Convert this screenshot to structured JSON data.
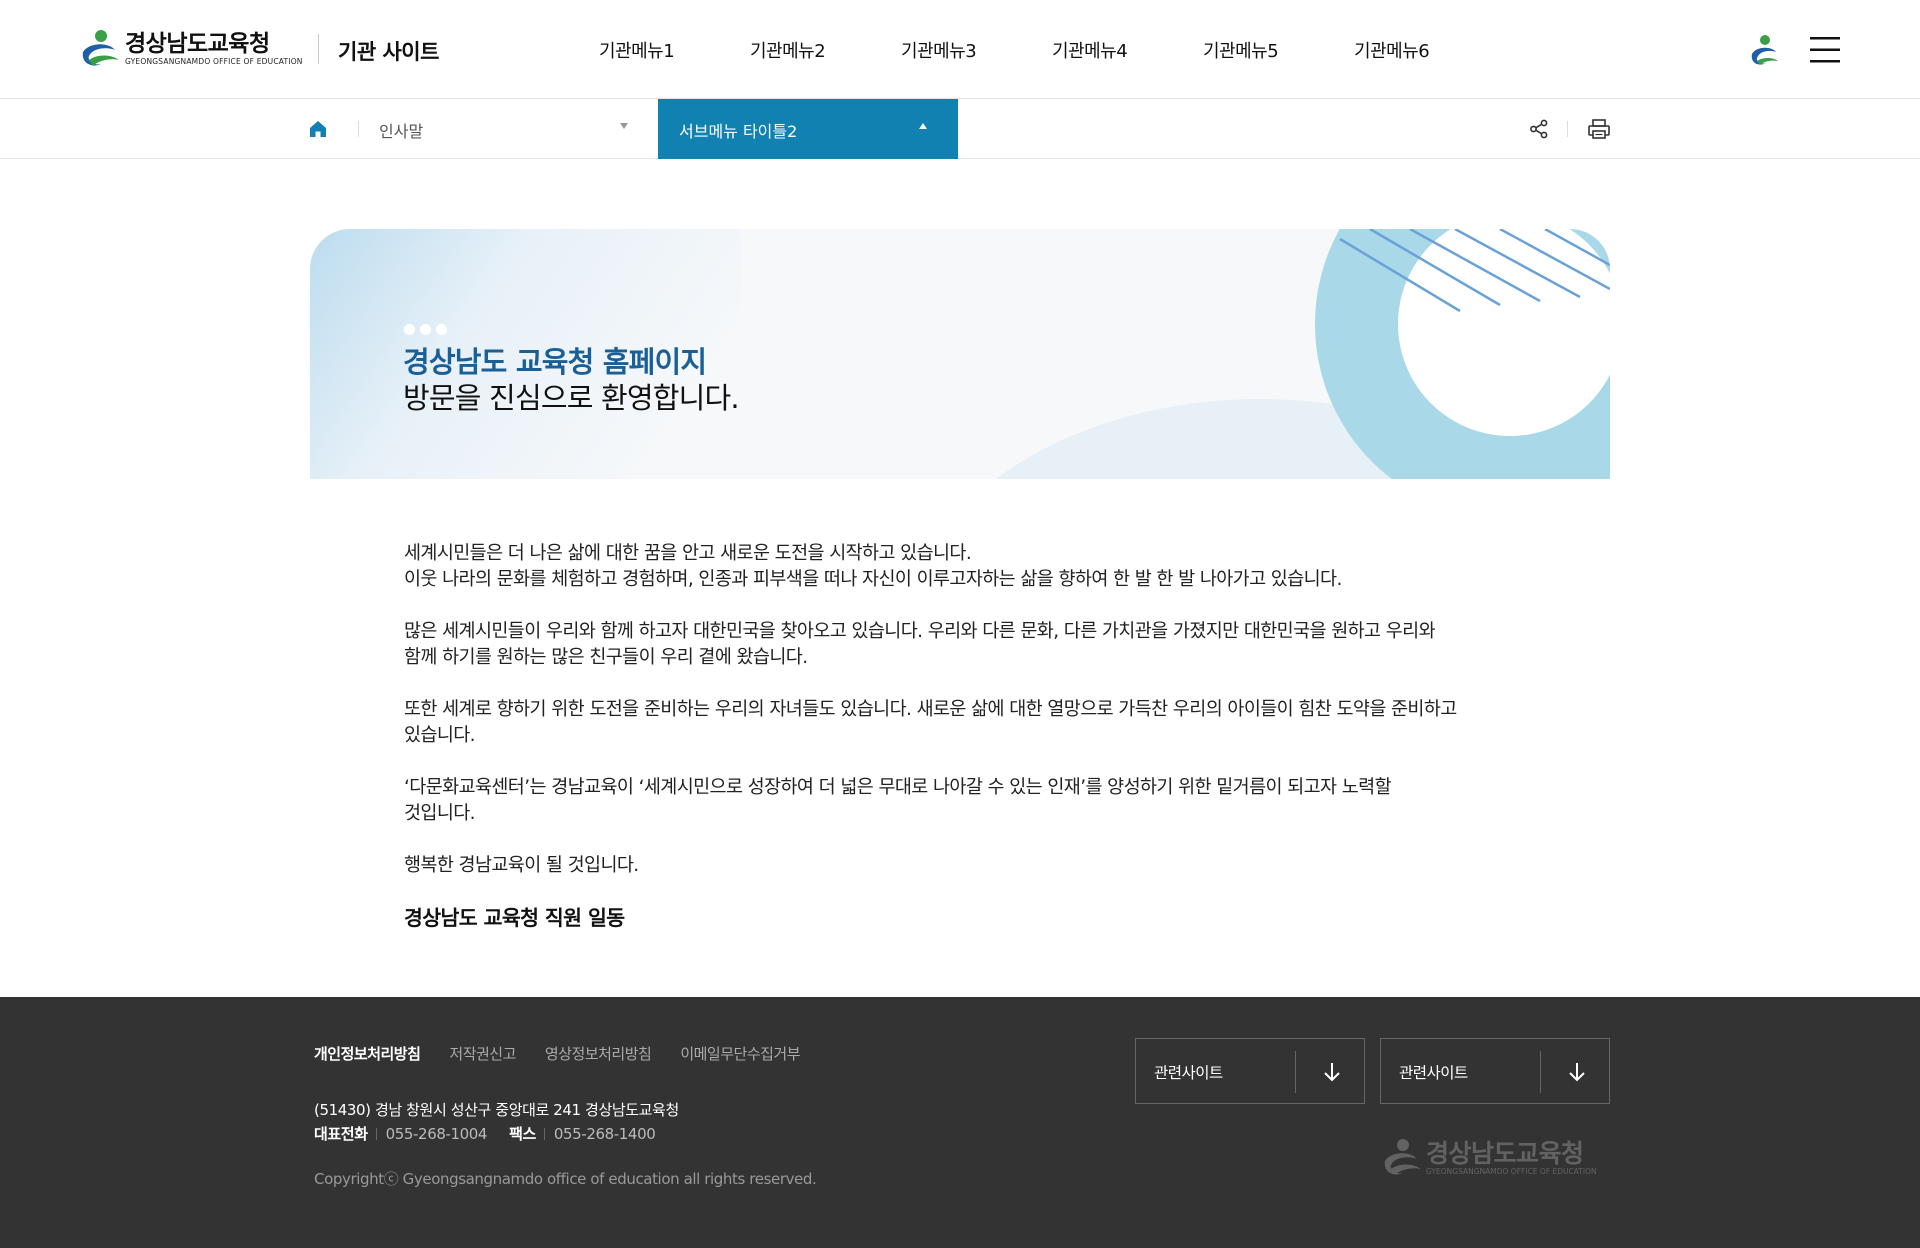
{
  "header": {
    "logo_ko": "경상남도교육청",
    "logo_en": "GYEONGSANGNAMDO OFFICE OF EDUCATION",
    "site_name": "기관 사이트",
    "gnb": [
      "기관메뉴1",
      "기관메뉴2",
      "기관메뉴3",
      "기관메뉴4",
      "기관메뉴5",
      "기관메뉴6"
    ],
    "icons": {
      "person": "person-logo-icon",
      "menu": "hamburger-menu-icon"
    }
  },
  "location": {
    "home_icon": "home-icon",
    "depth1": "인사말",
    "depth2": "서브메뉴 타이틀2",
    "share_icon": "share-icon",
    "print_icon": "print-icon",
    "active_color": "#1081b0"
  },
  "banner": {
    "title_highlight": "경상남도 교육청 홈페이지",
    "title_rest": "방문을 진심으로 환영합니다."
  },
  "content": {
    "paragraphs": [
      [
        "세계시민들은 더 나은 삶에 대한 꿈을 안고 새로운 도전을 시작하고 있습니다.",
        "이웃 나라의 문화를 체험하고 경험하며, 인종과 피부색을 떠나 자신이 이루고자하는 삶을 향하여 한 발 한 발 나아가고 있습니다."
      ],
      [
        "많은 세계시민들이 우리와 함께 하고자 대한민국을 찾아오고 있습니다. 우리와 다른 문화, 다른 가치관을 가졌지만 대한민국을 원하고 우리와",
        "함께 하기를 원하는 많은 친구들이 우리 곁에 왔습니다."
      ],
      [
        "또한 세계로 향하기 위한 도전을 준비하는 우리의 자녀들도 있습니다. 새로운 삶에 대한 열망으로 가득찬 우리의 아이들이 힘찬 도약을 준비하고",
        "있습니다."
      ],
      [
        "‘다문화교육센터’는 경남교육이 ‘세계시민으로 성장하여 더 넓은 무대로 나아갈 수 있는 인재’를 양성하기 위한 밑거름이 되고자 노력할",
        "것입니다."
      ],
      [
        "행복한 경남교육이 될 것입니다."
      ]
    ],
    "signature": "경상남도 교육청 직원 일동"
  },
  "footer": {
    "links": [
      "개인정보처리방침",
      "저작권신고",
      "영상정보처리방침",
      "이메일무단수집거부"
    ],
    "address": "(51430) 경남 창원시 성산구 중앙대로 241 경상남도교육청",
    "phone_label": "대표전화",
    "phone": "055-268-1004",
    "fax_label": "팩스",
    "fax": "055-268-1400",
    "copyright": "Copyrightⓒ Gyeongsangnamdo office of education all rights reserved.",
    "related1": "관련사이트",
    "related2": "관련사이트",
    "logo_ko": "경상남도교육청",
    "logo_en": "GYEONGSANGNAMDO OFFICE OF EDUCATION",
    "bg_color": "#333333"
  }
}
